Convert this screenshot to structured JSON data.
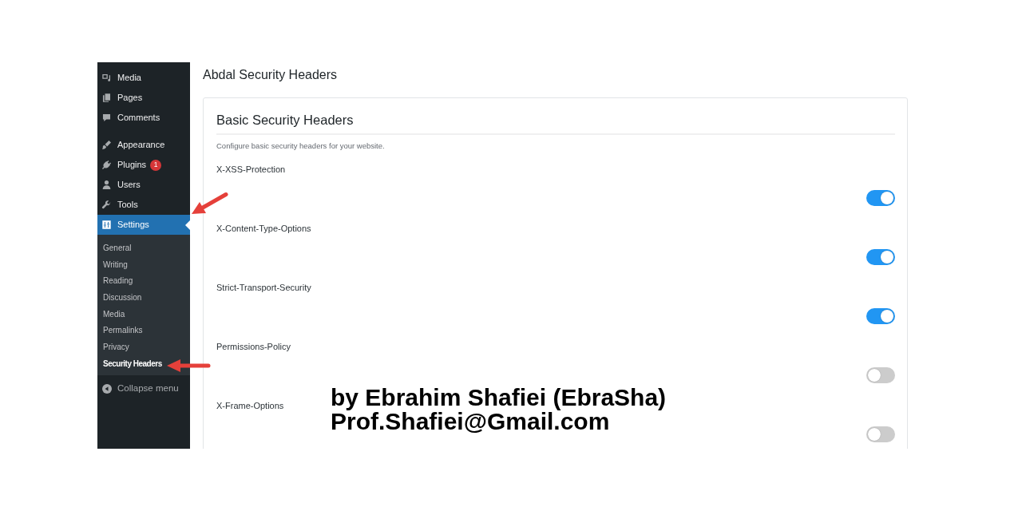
{
  "sidebar": {
    "groups": [
      {
        "items": [
          {
            "label": "Media",
            "selected": false
          },
          {
            "label": "Pages",
            "selected": false
          },
          {
            "label": "Comments",
            "selected": false
          }
        ]
      },
      {
        "items": [
          {
            "label": "Appearance",
            "selected": false
          },
          {
            "label": "Plugins",
            "badge": "1",
            "selected": false
          },
          {
            "label": "Users",
            "selected": false
          },
          {
            "label": "Tools",
            "selected": false
          },
          {
            "label": "Settings",
            "selected": true,
            "submenu": [
              {
                "label": "General",
                "selected": false
              },
              {
                "label": "Writing",
                "selected": false
              },
              {
                "label": "Reading",
                "selected": false
              },
              {
                "label": "Discussion",
                "selected": false
              },
              {
                "label": "Media",
                "selected": false
              },
              {
                "label": "Permalinks",
                "selected": false
              },
              {
                "label": "Privacy",
                "selected": false
              },
              {
                "label": "Security Headers",
                "selected": true
              }
            ]
          }
        ]
      }
    ],
    "collapse_label": "Collapse menu"
  },
  "page_title": "Abdal Security Headers",
  "card": {
    "title": "Basic Security Headers",
    "description": "Configure basic security headers for your website.",
    "settings": [
      {
        "label": "X-XSS-Protection",
        "on": true
      },
      {
        "label": "X-Content-Type-Options",
        "on": true
      },
      {
        "label": "Strict-Transport-Security",
        "on": true
      },
      {
        "label": "Permissions-Policy",
        "on": false
      },
      {
        "label": "X-Frame-Options",
        "on": false
      }
    ]
  },
  "credit": {
    "author": "by Ebrahim Shafiei (EbraSha)",
    "email": "Prof.Shafiei@Gmail.com"
  }
}
